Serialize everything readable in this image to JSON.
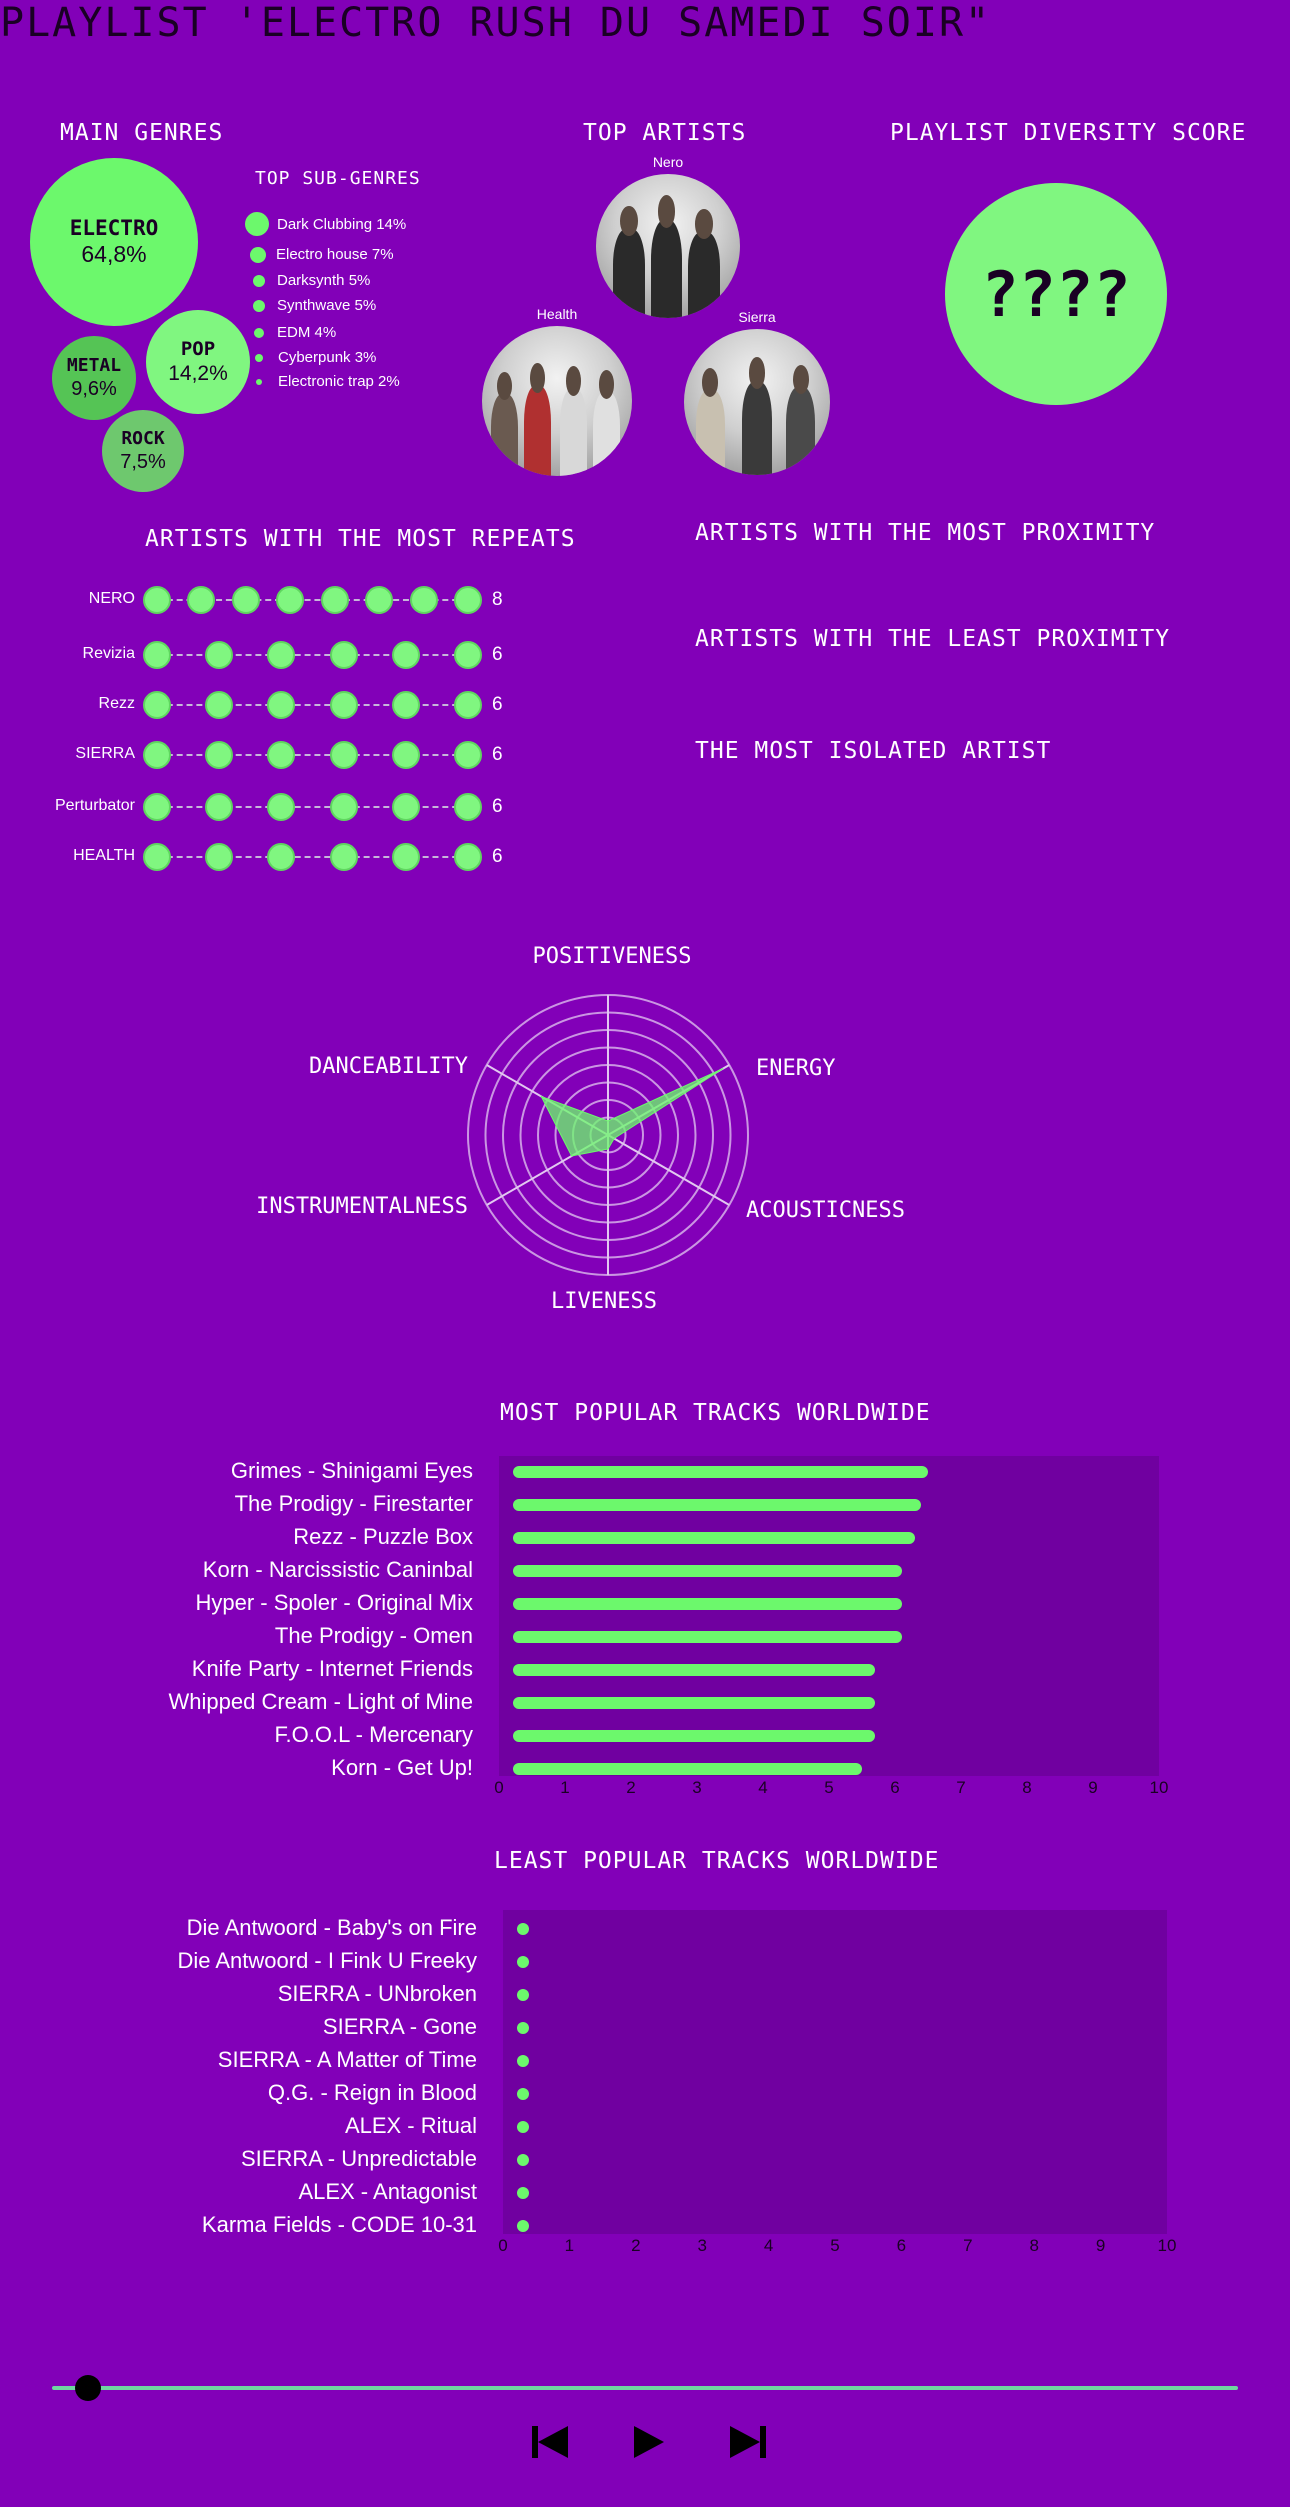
{
  "title": "PLAYLIST 'ELECTRO RUSH DU SAMEDI SOIR\"",
  "main_genres": {
    "title": "MAIN GENRES",
    "items": [
      {
        "name": "ELECTRO",
        "value": "64,8%"
      },
      {
        "name": "POP",
        "value": "14,2%"
      },
      {
        "name": "METAL",
        "value": "9,6%"
      },
      {
        "name": "ROCK",
        "value": "7,5%"
      }
    ]
  },
  "sub_genres": {
    "title": "TOP SUB-GENRES",
    "items": [
      "Dark Clubbing 14%",
      "Electro house 7%",
      "Darksynth 5%",
      "Synthwave 5%",
      "EDM 4%",
      "Cyberpunk 3%",
      "Electronic trap 2%"
    ]
  },
  "top_artists": {
    "title": "TOP ARTISTS",
    "items": [
      {
        "name": "Nero"
      },
      {
        "name": "Health"
      },
      {
        "name": "Sierra"
      }
    ]
  },
  "diversity": {
    "title": "PLAYLIST DIVERSITY SCORE",
    "value": "????"
  },
  "repeats": {
    "title": "ARTISTS WITH THE MOST REPEATS",
    "rows": [
      {
        "name": "NERO",
        "count": 8
      },
      {
        "name": "Revizia",
        "count": 6
      },
      {
        "name": "Rezz",
        "count": 6
      },
      {
        "name": "SIERRA",
        "count": 6
      },
      {
        "name": "Perturbator",
        "count": 6
      },
      {
        "name": "HEALTH",
        "count": 6
      }
    ]
  },
  "proximity": {
    "most": "ARTISTS WITH THE MOST PROXIMITY",
    "least": "ARTISTS WITH THE LEAST PROXIMITY",
    "isolated": "THE MOST ISOLATED ARTIST"
  },
  "colors": {
    "background": "#8200b8",
    "accent": "#6cf86c",
    "bubble_light": "#80f680",
    "panel": "#7000a0",
    "text_dark": "#1a0024"
  },
  "chart_data": [
    {
      "type": "radar",
      "axes": [
        "POSITIVENESS",
        "ENERGY",
        "ACOUSTICNESS",
        "LIVENESS",
        "INSTRUMENTALNESS",
        "DANCEABILITY"
      ],
      "values": [
        0.1,
        0.95,
        0.05,
        0.1,
        0.3,
        0.55
      ],
      "range": [
        0,
        1
      ],
      "rings": 8
    },
    {
      "type": "bar",
      "orientation": "horizontal",
      "title": "MOST POPULAR TRACKS WORLDWIDE",
      "categories": [
        "Grimes - Shinigami Eyes",
        "The Prodigy - Firestarter",
        "Rezz - Puzzle Box",
        "Korn - Narcissistic Caninbal",
        "Hyper - Spoler - Original Mix",
        "The Prodigy - Omen",
        "Knife Party - Internet Friends",
        "Whipped Cream - Light of Mine",
        "F.O.O.L - Mercenary",
        "Korn - Get Up!"
      ],
      "values": [
        6.5,
        6.4,
        6.3,
        6.1,
        6.1,
        6.1,
        5.7,
        5.7,
        5.7,
        5.5
      ],
      "xlim": [
        0,
        10
      ],
      "ticks": [
        0,
        1,
        2,
        3,
        4,
        5,
        6,
        7,
        8,
        9,
        10
      ]
    },
    {
      "type": "bar",
      "orientation": "horizontal",
      "title": "LEAST POPULAR TRACKS WORLDWIDE",
      "categories": [
        "Die Antwoord - Baby's on Fire",
        "Die Antwoord - I Fink U Freeky",
        "SIERRA - UNbroken",
        "SIERRA - Gone",
        "SIERRA - A Matter of Time",
        "Q.G. - Reign in Blood",
        "ALEX - Ritual",
        "SIERRA - Unpredictable",
        "ALEX - Antagonist",
        "Karma Fields - CODE 10-31"
      ],
      "values": [
        0.2,
        0.2,
        0.2,
        0.2,
        0.2,
        0.2,
        0.2,
        0.2,
        0.2,
        0.2
      ],
      "xlim": [
        0,
        10
      ],
      "ticks": [
        0,
        1,
        2,
        3,
        4,
        5,
        6,
        7,
        8,
        9,
        10
      ]
    }
  ],
  "player": {
    "progress": 0.03,
    "icons": [
      "skip-back-icon",
      "play-icon",
      "skip-forward-icon"
    ]
  }
}
